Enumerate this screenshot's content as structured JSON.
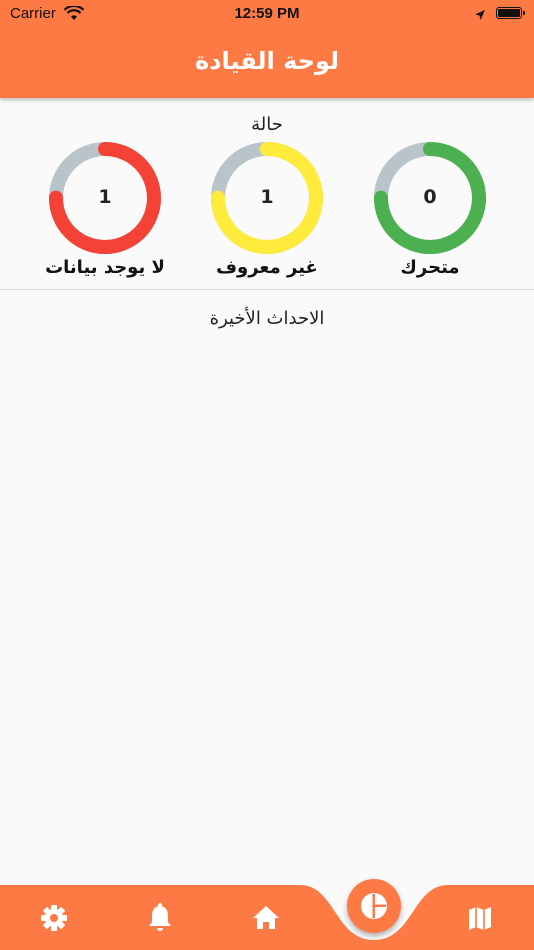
{
  "status_bar": {
    "carrier": "Carrier",
    "time": "12:59 PM"
  },
  "app_bar": {
    "title": "لوحة القيادة"
  },
  "status_section": {
    "title": "حالة",
    "gauges": [
      {
        "label": "متحرك",
        "value": "0",
        "color": "#4caf50",
        "fraction": 0.75
      },
      {
        "label": "غير معروف",
        "value": "1",
        "color": "#ffeb3b",
        "fraction": 0.75
      },
      {
        "label": "لا يوجد بيانات",
        "value": "1",
        "color": "#f44336",
        "fraction": 0.75
      }
    ],
    "track_color": "#b8c4ca"
  },
  "events_section": {
    "title": "الاحداث الأخيرة"
  },
  "bottom_nav": {
    "items": [
      "gear-icon",
      "bell-icon",
      "home-icon",
      "dashboard-icon",
      "map-icon"
    ],
    "active": "dashboard-icon",
    "accent_color": "#fe7a45"
  }
}
